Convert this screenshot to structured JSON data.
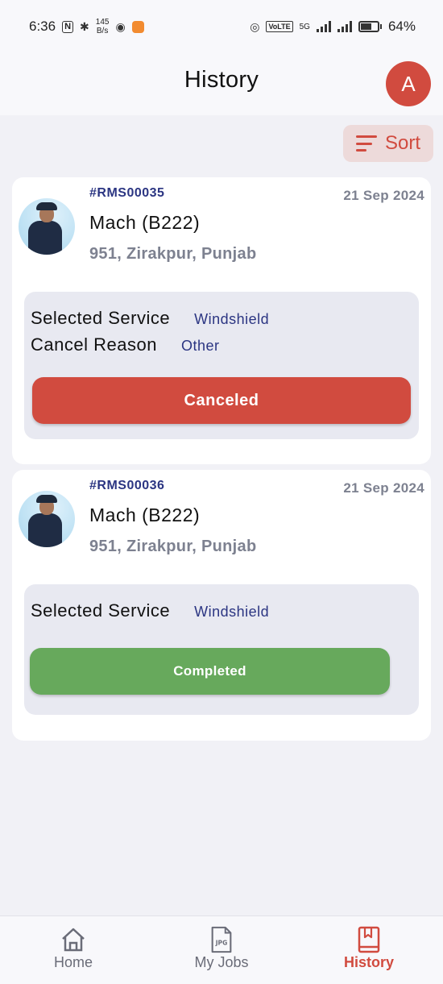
{
  "status_bar": {
    "time": "6:36",
    "net_speed_value": "145",
    "net_speed_unit": "B/s",
    "battery": "64%",
    "network": "5G"
  },
  "header": {
    "title": "History",
    "avatar_letter": "A"
  },
  "sort": {
    "label": "Sort"
  },
  "history": [
    {
      "id": "#RMS00035",
      "date": "21 Sep 2024",
      "vehicle": "Mach (B222)",
      "address": "951, Zirakpur, Punjab",
      "service_label": "Selected Service",
      "service_value": "Windshield",
      "cancel_label": "Cancel Reason",
      "cancel_value": "Other",
      "status": "Canceled"
    },
    {
      "id": "#RMS00036",
      "date": "21 Sep 2024",
      "vehicle": "Mach (B222)",
      "address": "951, Zirakpur, Punjab",
      "service_label": "Selected Service",
      "service_value": "Windshield",
      "status": "Completed"
    }
  ],
  "bottom_nav": {
    "items": [
      {
        "label": "Home",
        "icon": "home-icon"
      },
      {
        "label": "My Jobs",
        "icon": "jpg-file-icon"
      },
      {
        "label": "History",
        "icon": "history-book-icon"
      }
    ],
    "active": "History"
  },
  "colors": {
    "accent": "#d14b3f",
    "success": "#67a95c",
    "id_text": "#2b3582",
    "muted_text": "#7d8190",
    "background": "#f1f1f6"
  }
}
